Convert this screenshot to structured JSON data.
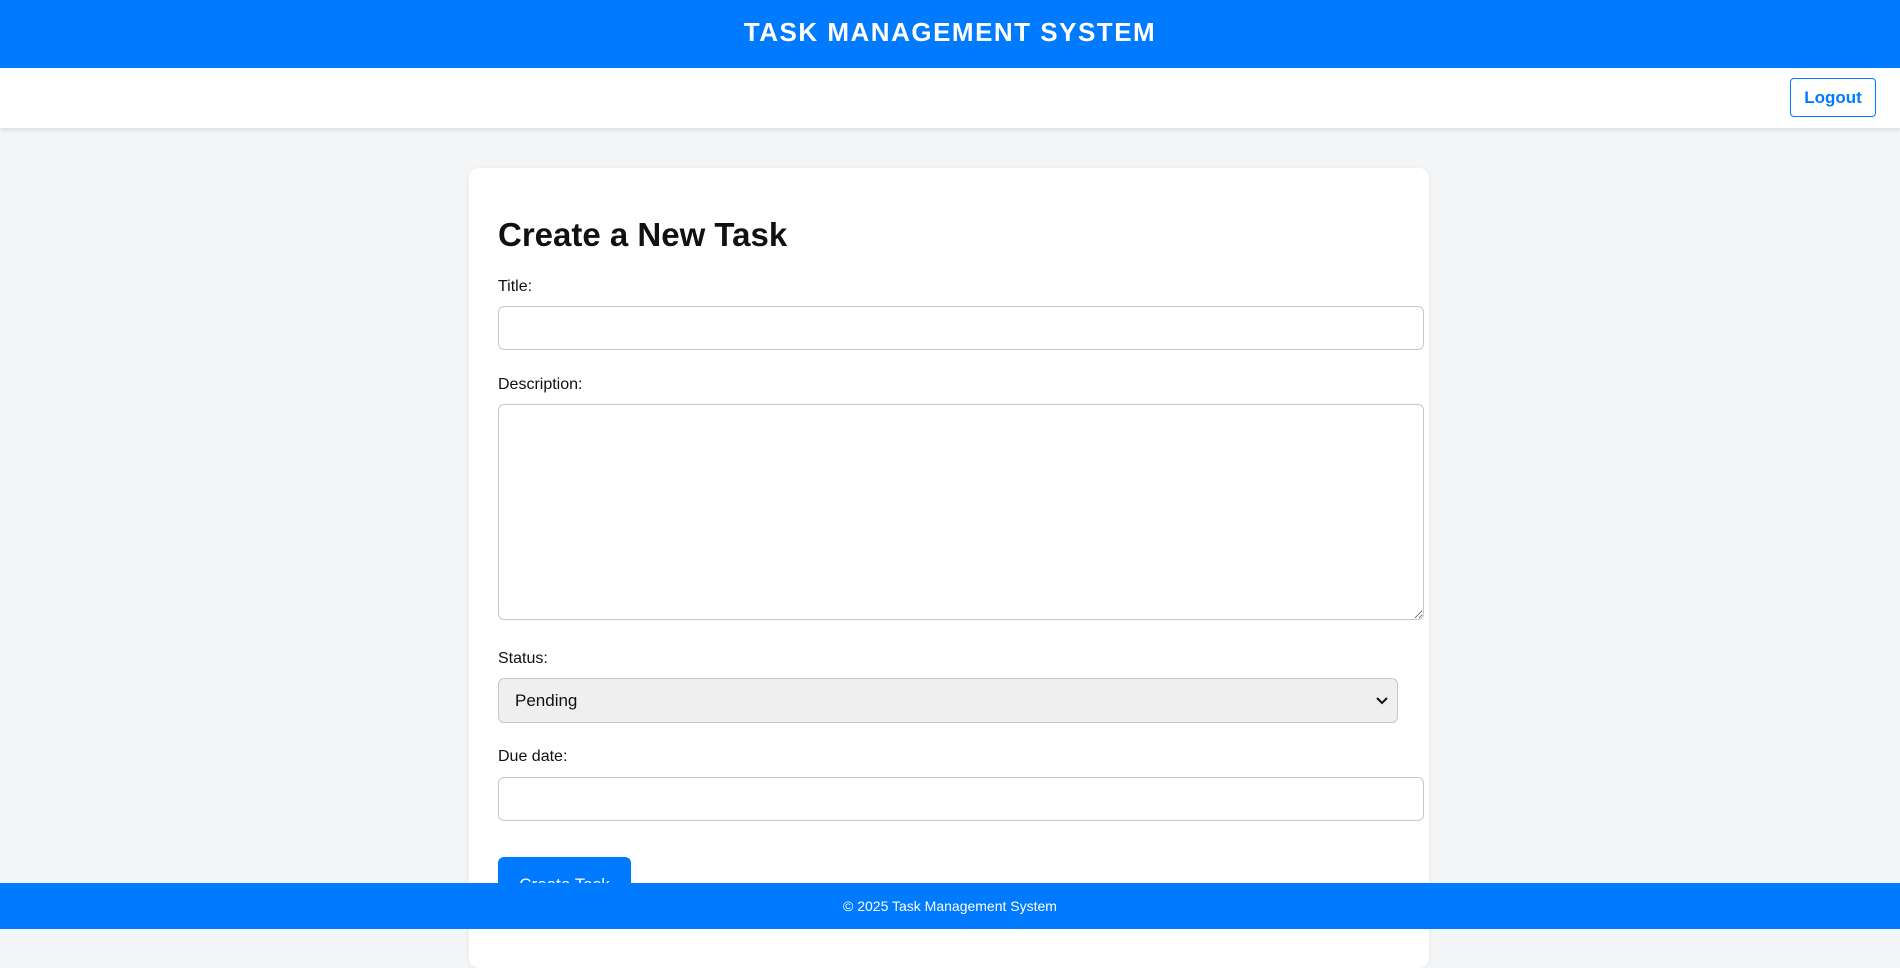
{
  "header": {
    "title": "TASK MANAGEMENT SYSTEM"
  },
  "nav": {
    "logout_label": "Logout"
  },
  "form": {
    "heading": "Create a New Task",
    "title_label": "Title:",
    "title_value": "",
    "description_label": "Description:",
    "description_value": "",
    "status_label": "Status:",
    "status_selected": "Pending",
    "due_date_label": "Due date:",
    "due_date_value": "",
    "submit_label": "Create Task"
  },
  "footer": {
    "text": "© 2025 Task Management System"
  },
  "colors": {
    "primary": "#007bff",
    "page_background": "#f4f5f7",
    "card_background": "#ffffff"
  },
  "icons": {
    "status_dropdown": "chevron-down-icon"
  }
}
